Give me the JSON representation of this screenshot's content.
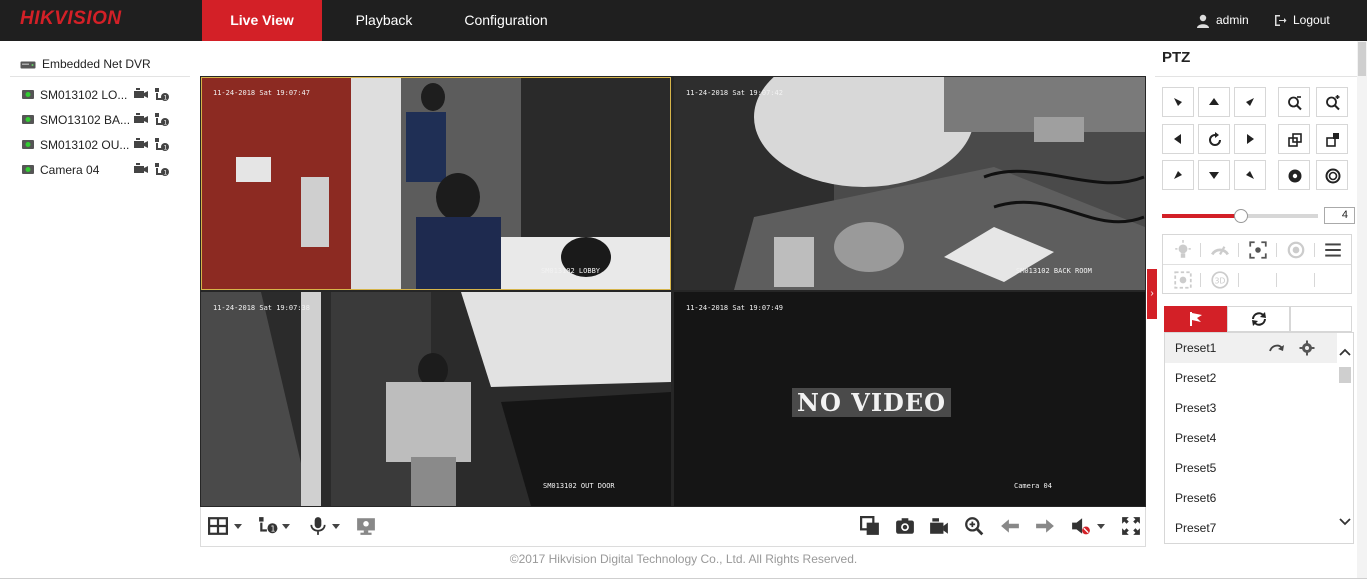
{
  "brand": {
    "logo": "HIKVISION",
    "accent": "#d32027",
    "topbar_bg": "#1f1f1f"
  },
  "nav": {
    "tabs": [
      {
        "label": "Live View",
        "active": true
      },
      {
        "label": "Playback",
        "active": false
      },
      {
        "label": "Configuration",
        "active": false
      }
    ]
  },
  "user": {
    "name": "admin",
    "logout": "Logout"
  },
  "device_tree": {
    "device": "Embedded Net DVR",
    "cameras": [
      {
        "label": "SM013102 LO..."
      },
      {
        "label": "SMO13102 BA..."
      },
      {
        "label": "SM013102 OU..."
      },
      {
        "label": "Camera 04"
      }
    ]
  },
  "video": {
    "tiles": [
      {
        "timestamp": "11-24-2018 Sat 19:07:47",
        "label": "SM013102 LOBBY",
        "selected": true
      },
      {
        "timestamp": "11-24-2018 Sat 19:07:42",
        "label": "SM013102 BACK ROOM",
        "selected": false
      },
      {
        "timestamp": "11-24-2018 Sat 19:07:38",
        "label": "SM013102 OUT DOOR",
        "selected": false
      },
      {
        "timestamp": "11-24-2018 Sat 19:07:49",
        "label": "Camera 04",
        "no_video": "NO VIDEO",
        "selected": false
      }
    ]
  },
  "toolbar": {
    "left_icons": [
      "layout-icon",
      "stream-icon",
      "microphone-icon",
      "video-wall-icon"
    ],
    "right_icons": [
      "stop-all-icon",
      "capture-icon",
      "record-icon",
      "digital-zoom-icon",
      "previous-page-icon",
      "next-page-icon",
      "volume-mute-icon",
      "fullscreen-icon"
    ]
  },
  "footer": "©2017 Hikvision Digital Technology Co., Ltd. All Rights Reserved.",
  "ptz": {
    "title": "PTZ",
    "speed": "4",
    "speed_level": 0.5,
    "presets": [
      "Preset1",
      "Preset2",
      "Preset3",
      "Preset4",
      "Preset5",
      "Preset6",
      "Preset7"
    ]
  }
}
